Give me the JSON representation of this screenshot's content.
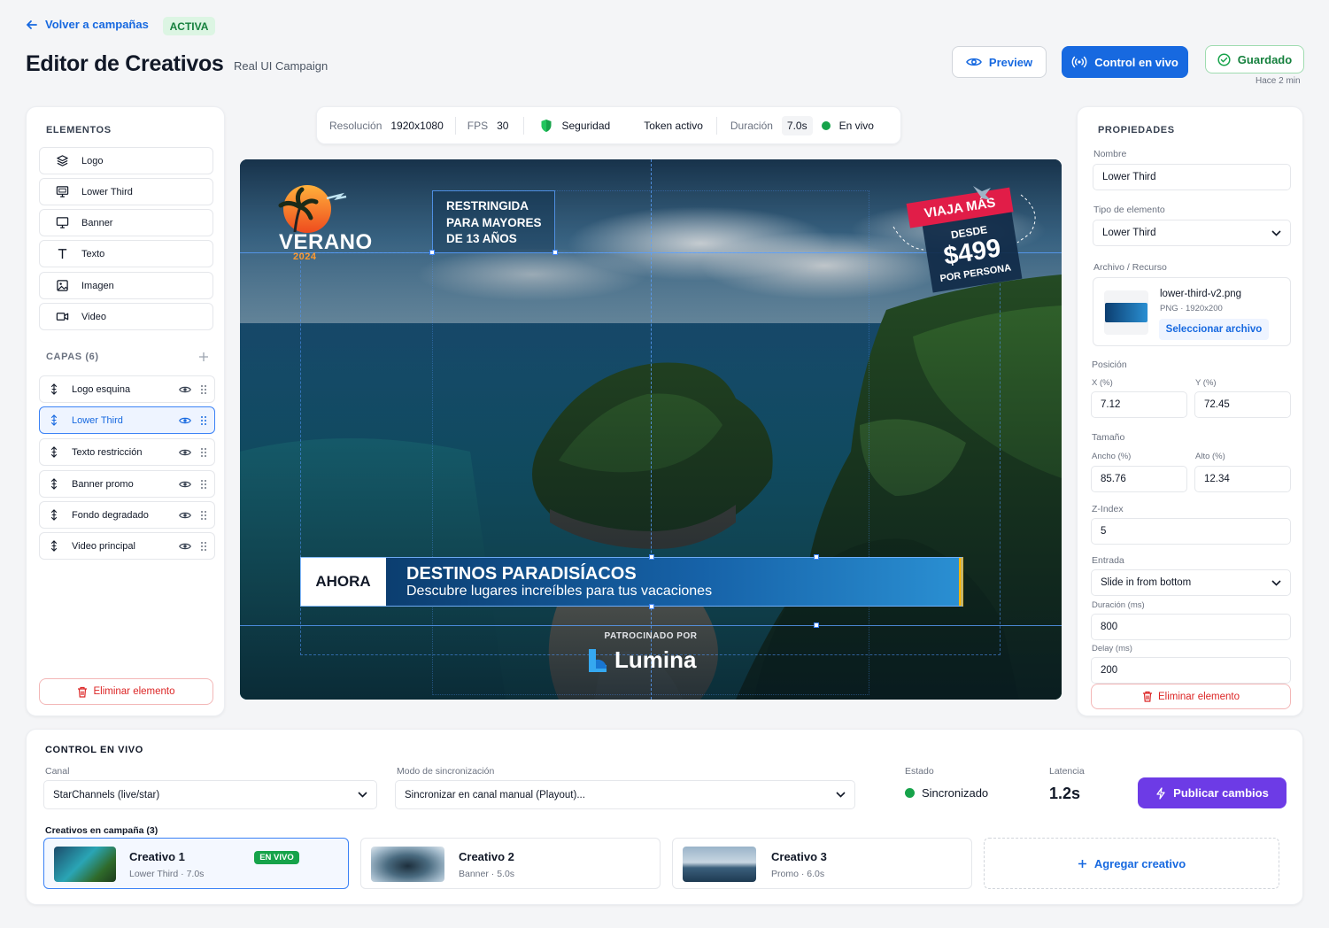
{
  "header": {
    "back_label": "Volver a campañas",
    "status_badge": "ACTIVA",
    "title": "Editor de Creativos",
    "campaign_name": "Real UI Campaign",
    "preview_label": "Preview",
    "live_control_label": "Control en vivo",
    "saved_label": "Guardado",
    "saved_time": "Hace 2 min"
  },
  "elements_panel": {
    "title": "ELEMENTOS",
    "items": [
      {
        "label": "Logo",
        "icon": "layers-icon"
      },
      {
        "label": "Lower Third",
        "icon": "monitor-icon"
      },
      {
        "label": "Banner",
        "icon": "monitor-icon"
      },
      {
        "label": "Texto",
        "icon": "text-icon"
      },
      {
        "label": "Imagen",
        "icon": "image-icon"
      },
      {
        "label": "Video",
        "icon": "video-icon"
      }
    ],
    "layers_title": "CAPAS (6)",
    "layers": [
      {
        "label": "Logo esquina"
      },
      {
        "label": "Lower Third",
        "selected": true
      },
      {
        "label": "Texto restricción"
      },
      {
        "label": "Banner promo"
      },
      {
        "label": "Fondo degradado"
      },
      {
        "label": "Video principal"
      }
    ],
    "delete_label": "Eliminar elemento"
  },
  "canvas_stats": {
    "resolution_label": "Resolución",
    "resolution_value": "1920x1080",
    "fps_label": "FPS",
    "fps_value": "30",
    "security_label": "Seguridad",
    "token_label": "Token activo",
    "duration_label": "Duración",
    "duration_value": "7.0s",
    "live_label": "En vivo"
  },
  "canvas": {
    "logo_title": "VERANO",
    "logo_year": "2024",
    "restriction_text": [
      "RESTRINGIDA",
      "PARA MAYORES",
      "DE 13 AÑOS"
    ],
    "promo_ribbon": "VIAJA MÁS",
    "promo_from": "DESDE",
    "promo_price": "$499",
    "promo_per": "POR PERSONA",
    "lower_third_tag": "AHORA",
    "lower_third_title": "DESTINOS PARADISÍACOS",
    "lower_third_subtitle": "Descubre lugares increíbles para tus vacaciones",
    "sponsor_label": "PATROCINADO POR",
    "sponsor_name": "Lumina"
  },
  "properties": {
    "title": "PROPIEDADES",
    "name_label": "Nombre",
    "name_value": "Lower Third",
    "type_label": "Tipo de elemento",
    "type_value": "Lower Third",
    "file_label": "Archivo / Recurso",
    "file_name": "lower-third-v2.png",
    "file_meta": "PNG · 1920x200",
    "file_button": "Seleccionar archivo",
    "position_label": "Posición",
    "x_label": "X (%)",
    "x_value": "7.12",
    "y_label": "Y (%)",
    "y_value": "72.45",
    "size_label": "Tamaño",
    "width_label": "Ancho (%)",
    "width_value": "85.76",
    "height_label": "Alto (%)",
    "height_value": "12.34",
    "z_label": "Z-Index",
    "z_value": "5",
    "entry_label": "Entrada",
    "entry_value": "Slide in from bottom",
    "duration_label": "Duración (ms)",
    "duration_value": "800",
    "delay_label": "Delay (ms)",
    "delay_value": "200",
    "delete_label": "Eliminar elemento"
  },
  "live_control": {
    "title": "CONTROL EN VIVO",
    "channel_label": "Canal",
    "channel_value": "StarChannels (live/star)",
    "sync_label": "Modo de sincronización",
    "sync_value": "Sincronizar en canal manual (Playout)...",
    "state_label": "Estado",
    "state_value": "Sincronizado",
    "latency_label": "Latencia",
    "latency_value": "1.2s",
    "publish_label": "Publicar cambios",
    "creatives_label": "Creativos en campaña (3)",
    "creatives": [
      {
        "name": "Creativo 1",
        "meta": "Lower Third · 7.0s",
        "badge": "EN VIVO"
      },
      {
        "name": "Creativo 2",
        "meta": "Banner · 5.0s"
      },
      {
        "name": "Creativo 3",
        "meta": "Promo · 6.0s"
      }
    ],
    "add_label": "Agregar creativo"
  },
  "colors": {
    "primary": "#1769e0",
    "success": "#16a34a",
    "danger": "#dc2626",
    "purple": "#6d3be6"
  }
}
